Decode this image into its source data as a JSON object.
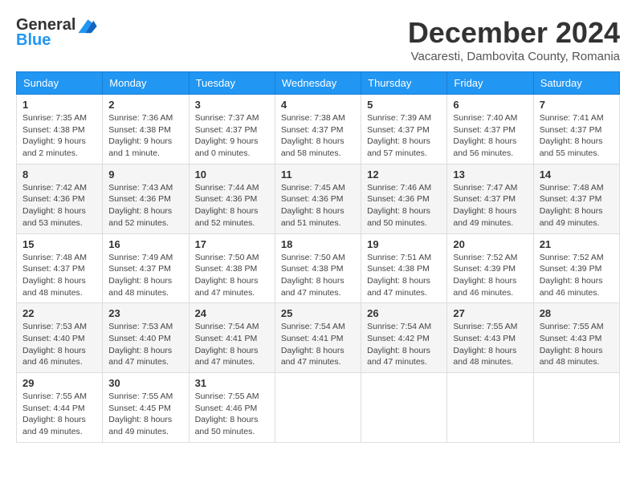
{
  "header": {
    "logo_line1": "General",
    "logo_line2": "Blue",
    "month_title": "December 2024",
    "location": "Vacaresti, Dambovita County, Romania"
  },
  "days_of_week": [
    "Sunday",
    "Monday",
    "Tuesday",
    "Wednesday",
    "Thursday",
    "Friday",
    "Saturday"
  ],
  "weeks": [
    [
      {
        "day": "1",
        "info": "Sunrise: 7:35 AM\nSunset: 4:38 PM\nDaylight: 9 hours\nand 2 minutes."
      },
      {
        "day": "2",
        "info": "Sunrise: 7:36 AM\nSunset: 4:38 PM\nDaylight: 9 hours\nand 1 minute."
      },
      {
        "day": "3",
        "info": "Sunrise: 7:37 AM\nSunset: 4:37 PM\nDaylight: 9 hours\nand 0 minutes."
      },
      {
        "day": "4",
        "info": "Sunrise: 7:38 AM\nSunset: 4:37 PM\nDaylight: 8 hours\nand 58 minutes."
      },
      {
        "day": "5",
        "info": "Sunrise: 7:39 AM\nSunset: 4:37 PM\nDaylight: 8 hours\nand 57 minutes."
      },
      {
        "day": "6",
        "info": "Sunrise: 7:40 AM\nSunset: 4:37 PM\nDaylight: 8 hours\nand 56 minutes."
      },
      {
        "day": "7",
        "info": "Sunrise: 7:41 AM\nSunset: 4:37 PM\nDaylight: 8 hours\nand 55 minutes."
      }
    ],
    [
      {
        "day": "8",
        "info": "Sunrise: 7:42 AM\nSunset: 4:36 PM\nDaylight: 8 hours\nand 53 minutes."
      },
      {
        "day": "9",
        "info": "Sunrise: 7:43 AM\nSunset: 4:36 PM\nDaylight: 8 hours\nand 52 minutes."
      },
      {
        "day": "10",
        "info": "Sunrise: 7:44 AM\nSunset: 4:36 PM\nDaylight: 8 hours\nand 52 minutes."
      },
      {
        "day": "11",
        "info": "Sunrise: 7:45 AM\nSunset: 4:36 PM\nDaylight: 8 hours\nand 51 minutes."
      },
      {
        "day": "12",
        "info": "Sunrise: 7:46 AM\nSunset: 4:36 PM\nDaylight: 8 hours\nand 50 minutes."
      },
      {
        "day": "13",
        "info": "Sunrise: 7:47 AM\nSunset: 4:37 PM\nDaylight: 8 hours\nand 49 minutes."
      },
      {
        "day": "14",
        "info": "Sunrise: 7:48 AM\nSunset: 4:37 PM\nDaylight: 8 hours\nand 49 minutes."
      }
    ],
    [
      {
        "day": "15",
        "info": "Sunrise: 7:48 AM\nSunset: 4:37 PM\nDaylight: 8 hours\nand 48 minutes."
      },
      {
        "day": "16",
        "info": "Sunrise: 7:49 AM\nSunset: 4:37 PM\nDaylight: 8 hours\nand 48 minutes."
      },
      {
        "day": "17",
        "info": "Sunrise: 7:50 AM\nSunset: 4:38 PM\nDaylight: 8 hours\nand 47 minutes."
      },
      {
        "day": "18",
        "info": "Sunrise: 7:50 AM\nSunset: 4:38 PM\nDaylight: 8 hours\nand 47 minutes."
      },
      {
        "day": "19",
        "info": "Sunrise: 7:51 AM\nSunset: 4:38 PM\nDaylight: 8 hours\nand 47 minutes."
      },
      {
        "day": "20",
        "info": "Sunrise: 7:52 AM\nSunset: 4:39 PM\nDaylight: 8 hours\nand 46 minutes."
      },
      {
        "day": "21",
        "info": "Sunrise: 7:52 AM\nSunset: 4:39 PM\nDaylight: 8 hours\nand 46 minutes."
      }
    ],
    [
      {
        "day": "22",
        "info": "Sunrise: 7:53 AM\nSunset: 4:40 PM\nDaylight: 8 hours\nand 46 minutes."
      },
      {
        "day": "23",
        "info": "Sunrise: 7:53 AM\nSunset: 4:40 PM\nDaylight: 8 hours\nand 47 minutes."
      },
      {
        "day": "24",
        "info": "Sunrise: 7:54 AM\nSunset: 4:41 PM\nDaylight: 8 hours\nand 47 minutes."
      },
      {
        "day": "25",
        "info": "Sunrise: 7:54 AM\nSunset: 4:41 PM\nDaylight: 8 hours\nand 47 minutes."
      },
      {
        "day": "26",
        "info": "Sunrise: 7:54 AM\nSunset: 4:42 PM\nDaylight: 8 hours\nand 47 minutes."
      },
      {
        "day": "27",
        "info": "Sunrise: 7:55 AM\nSunset: 4:43 PM\nDaylight: 8 hours\nand 48 minutes."
      },
      {
        "day": "28",
        "info": "Sunrise: 7:55 AM\nSunset: 4:43 PM\nDaylight: 8 hours\nand 48 minutes."
      }
    ],
    [
      {
        "day": "29",
        "info": "Sunrise: 7:55 AM\nSunset: 4:44 PM\nDaylight: 8 hours\nand 49 minutes."
      },
      {
        "day": "30",
        "info": "Sunrise: 7:55 AM\nSunset: 4:45 PM\nDaylight: 8 hours\nand 49 minutes."
      },
      {
        "day": "31",
        "info": "Sunrise: 7:55 AM\nSunset: 4:46 PM\nDaylight: 8 hours\nand 50 minutes."
      },
      null,
      null,
      null,
      null
    ]
  ]
}
